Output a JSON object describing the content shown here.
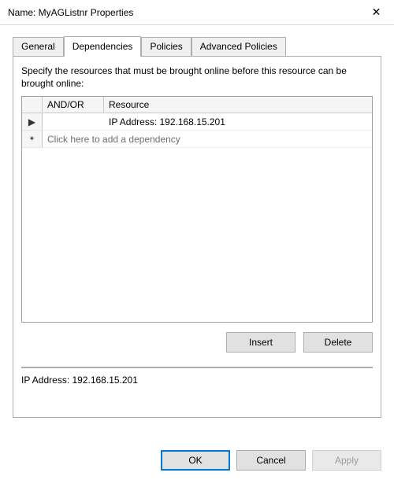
{
  "window": {
    "title": "Name: MyAGListnr Properties"
  },
  "tabs": {
    "general": "General",
    "dependencies": "Dependencies",
    "policies": "Policies",
    "advanced_policies": "Advanced Policies",
    "active_index": 1
  },
  "panel": {
    "instruction": "Specify the resources that must be brought online before this resource can be brought online:",
    "columns": {
      "andor": "AND/OR",
      "resource": "Resource"
    },
    "rows": [
      {
        "andor": "",
        "resource": "IP Address: 192.168.15.201"
      }
    ],
    "new_row_placeholder": "Click here to add a dependency",
    "buttons": {
      "insert": "Insert",
      "delete": "Delete"
    },
    "status": "IP Address: 192.168.15.201"
  },
  "footer": {
    "ok": "OK",
    "cancel": "Cancel",
    "apply": "Apply"
  }
}
